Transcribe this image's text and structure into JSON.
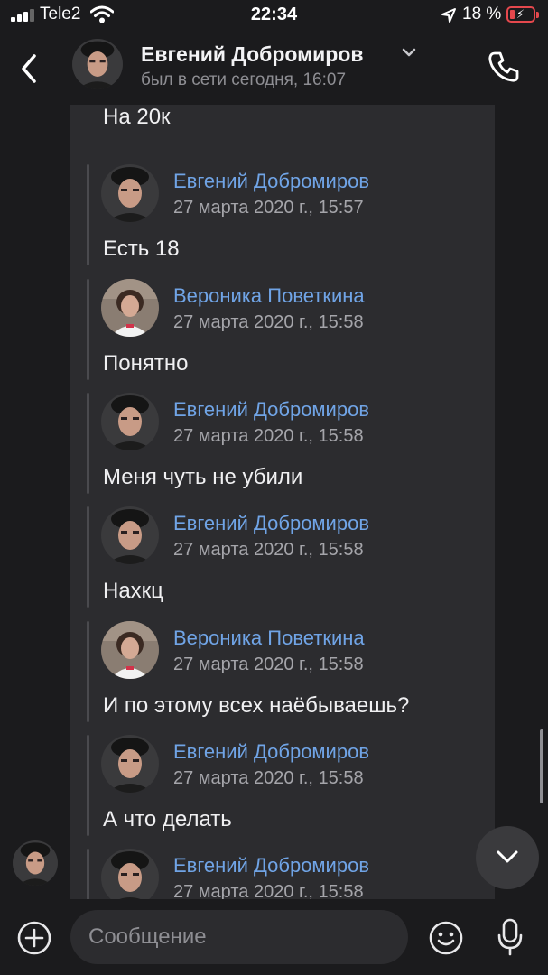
{
  "status_bar": {
    "carrier": "Tele2",
    "time": "22:34",
    "battery": "18 %",
    "icons": [
      "signal-icon",
      "wifi-icon",
      "location-arrow-icon",
      "battery-charging-icon"
    ]
  },
  "header": {
    "name": "Евгений Добромиров",
    "status": "был в сети сегодня, 16:07",
    "icons": [
      "back-chevron-icon",
      "chevron-down-icon",
      "phone-icon"
    ]
  },
  "messages": [
    {
      "author": "",
      "date": "",
      "text": "На 20к"
    },
    {
      "author": "Евгений Добромиров",
      "date": "27 марта 2020 г., 15:57",
      "text": "Есть 18"
    },
    {
      "author": "Вероника Поветкина",
      "date": "27 марта 2020 г., 15:58",
      "text": "Понятно"
    },
    {
      "author": "Евгений Добромиров",
      "date": "27 марта 2020 г., 15:58",
      "text": "Меня чуть не убили"
    },
    {
      "author": "Евгений Добромиров",
      "date": "27 марта 2020 г., 15:58",
      "text": "Нахкц"
    },
    {
      "author": "Вероника Поветкина",
      "date": "27 марта 2020 г., 15:58",
      "text": "И по этому всех наёбываешь?"
    },
    {
      "author": "Евгений Добромиров",
      "date": "27 марта 2020 г., 15:58",
      "text": "А что делать"
    },
    {
      "author": "Евгений Добромиров",
      "date": "27 марта 2020 г., 15:58",
      "text": ""
    }
  ],
  "composer": {
    "placeholder": "Сообщение",
    "icons": [
      "add-icon",
      "emoji-icon",
      "microphone-icon"
    ]
  },
  "colors": {
    "background": "#1b1b1d",
    "bubble": "#2c2c2f",
    "author_link": "#70a4e6",
    "date_text": "#a5a5aa",
    "battery_low": "#e5484d"
  }
}
